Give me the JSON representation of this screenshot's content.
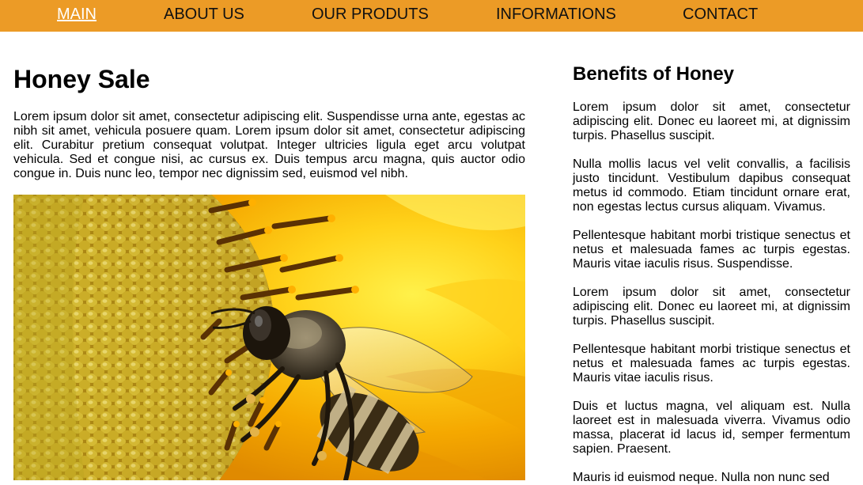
{
  "nav": {
    "items": [
      {
        "label": "MAIN",
        "active": true
      },
      {
        "label": "ABOUT US",
        "active": false
      },
      {
        "label": "OUR PRODUTS",
        "active": false
      },
      {
        "label": "INFORMATIONS",
        "active": false
      },
      {
        "label": "CONTACT",
        "active": false
      }
    ]
  },
  "main": {
    "title": "Honey Sale",
    "paragraph": "Lorem ipsum dolor sit amet, consectetur adipiscing elit. Suspendisse urna ante, egestas ac nibh sit amet, vehicula posuere quam. Lorem ipsum dolor sit amet, consectetur adipiscing elit. Curabitur pretium consequat volutpat. Integer ultricies ligula eget arcu volutpat vehicula. Sed et congue nisi, ac cursus ex. Duis tempus arcu magna, quis auctor odio congue in. Duis nunc leo, tempor nec dignissim sed, euismod vel nibh."
  },
  "sidebar": {
    "title": "Benefits of Honey",
    "paragraphs": [
      "Lorem ipsum dolor sit amet, consectetur adipiscing elit. Donec eu laoreet mi, at dignissim turpis. Phasellus suscipit.",
      "Nulla mollis lacus vel velit convallis, a facilisis justo tincidunt. Vestibulum dapibus consequat metus id commodo. Etiam tincidunt ornare erat, non egestas lectus cursus aliquam. Vivamus.",
      "Pellentesque habitant morbi tristique senectus et netus et malesuada fames ac turpis egestas. Mauris vitae iaculis risus. Suspendisse.",
      "Lorem ipsum dolor sit amet, consectetur adipiscing elit. Donec eu laoreet mi, at dignissim turpis. Phasellus suscipit.",
      "Pellentesque habitant morbi tristique senectus et netus et malesuada fames ac turpis egestas. Mauris vitae iaculis risus.",
      "Duis et luctus magna, vel aliquam est. Nulla laoreet est in malesuada viverra. Vivamus odio massa, placerat id lacus id, semper fermentum sapien. Praesent.",
      "Mauris id euismod neque. Nulla non nunc sed"
    ]
  },
  "colors": {
    "nav_background": "#ec9b26",
    "nav_active_text": "#ffffff",
    "nav_text": "#111111"
  }
}
